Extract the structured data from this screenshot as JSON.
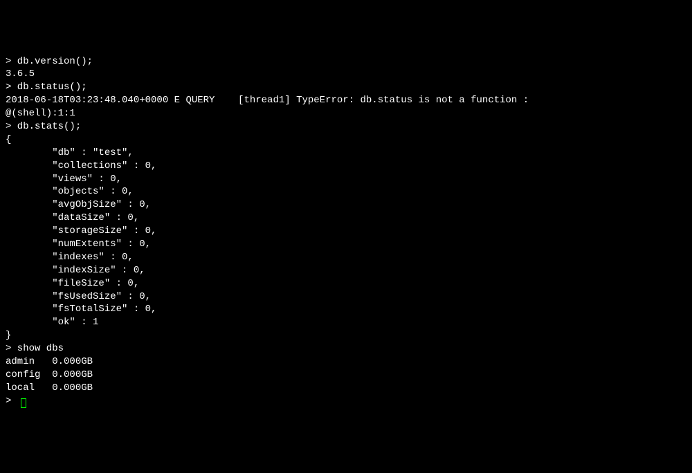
{
  "terminal": {
    "lines": [
      "> db.version();",
      "3.6.5",
      "> db.status();",
      "2018-06-18T03:23:48.040+0000 E QUERY    [thread1] TypeError: db.status is not a function :",
      "@(shell):1:1",
      "> db.stats();",
      "{",
      "        \"db\" : \"test\",",
      "        \"collections\" : 0,",
      "        \"views\" : 0,",
      "        \"objects\" : 0,",
      "        \"avgObjSize\" : 0,",
      "        \"dataSize\" : 0,",
      "        \"storageSize\" : 0,",
      "        \"numExtents\" : 0,",
      "        \"indexes\" : 0,",
      "        \"indexSize\" : 0,",
      "        \"fileSize\" : 0,",
      "        \"fsUsedSize\" : 0,",
      "        \"fsTotalSize\" : 0,",
      "        \"ok\" : 1",
      "}",
      "> show dbs",
      "admin   0.000GB",
      "config  0.000GB",
      "local   0.000GB",
      ">"
    ]
  }
}
